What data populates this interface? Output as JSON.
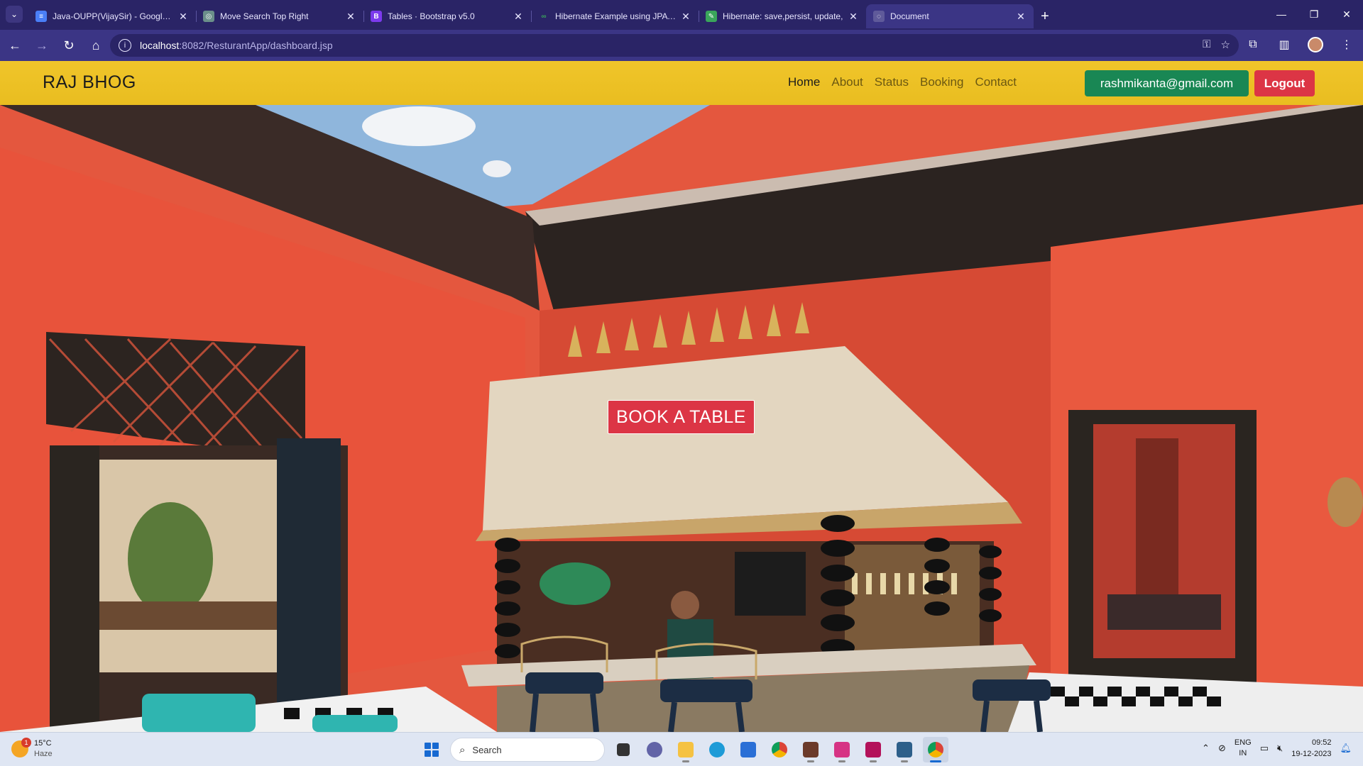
{
  "browser": {
    "tabs": [
      {
        "title": "Java-OUPP(VijaySir) - Google D",
        "favicon": "docs-icon",
        "color": "#4a7ef7",
        "glyph": "≡"
      },
      {
        "title": "Move Search Top Right",
        "favicon": "chatgpt-icon",
        "color": "#6b8f8a",
        "glyph": "◎"
      },
      {
        "title": "Tables · Bootstrap v5.0",
        "favicon": "bootstrap-icon",
        "color": "#7c3aed",
        "glyph": "B"
      },
      {
        "title": "Hibernate Example using JPA ar",
        "favicon": "link-icon",
        "color": "#2a2466",
        "glyph": "∞"
      },
      {
        "title": "Hibernate: save,persist, update,",
        "favicon": "leaf-icon",
        "color": "#3aa55b",
        "glyph": "✎"
      },
      {
        "title": "Document",
        "favicon": "globe-icon",
        "color": "#5f5a9a",
        "glyph": "◌"
      }
    ],
    "active_tab_index": 5,
    "url_host": "localhost",
    "url_path": ":8082/ResturantApp/dashboard.jsp"
  },
  "site": {
    "brand": "RAJ BHOG",
    "nav": [
      {
        "label": "Home",
        "active": true
      },
      {
        "label": "About",
        "active": false
      },
      {
        "label": "Status",
        "active": false
      },
      {
        "label": "Booking",
        "active": false
      },
      {
        "label": "Contact",
        "active": false
      }
    ],
    "user_email": "rashmikanta@gmail.com",
    "logout_label": "Logout",
    "cta_label": "BOOK A TABLE",
    "colors": {
      "navbar": "#f0c52a",
      "success": "#198754",
      "danger": "#dc3545"
    }
  },
  "taskbar": {
    "weather_temp": "15°C",
    "weather_desc": "Haze",
    "weather_badge": "1",
    "search_placeholder": "Search",
    "lang_top": "ENG",
    "lang_bottom": "IN",
    "time": "09:52",
    "date": "19-12-2023"
  }
}
